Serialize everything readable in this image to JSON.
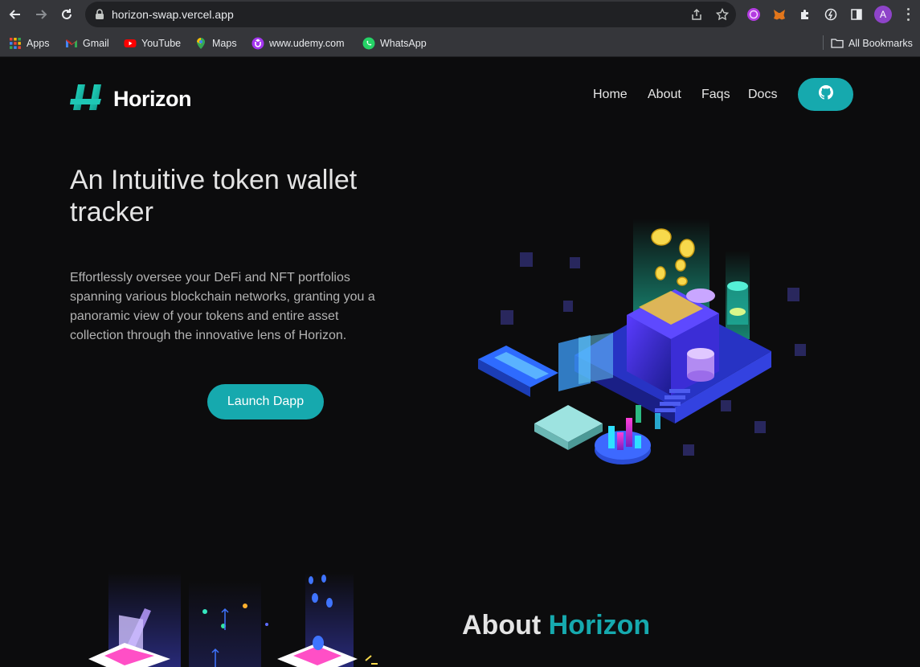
{
  "browser": {
    "url": "horizon-swap.vercel.app",
    "avatar_letter": "A",
    "bookmarks": [
      {
        "label": "Apps",
        "icon": "apps-grid-icon"
      },
      {
        "label": "Gmail",
        "icon": "gmail-icon"
      },
      {
        "label": "YouTube",
        "icon": "youtube-icon"
      },
      {
        "label": "Maps",
        "icon": "maps-icon"
      },
      {
        "label": "www.udemy.com",
        "icon": "udemy-icon"
      },
      {
        "label": "WhatsApp",
        "icon": "whatsapp-icon"
      }
    ],
    "all_bookmarks": "All Bookmarks"
  },
  "header": {
    "logo_text": "Horizon",
    "nav": [
      "Home",
      "About",
      "Faqs",
      "Docs"
    ],
    "github_icon": "github-icon"
  },
  "hero": {
    "title": "An Intuitive token wallet tracker",
    "description": "Effortlessly oversee your DeFi and NFT portfolios spanning various blockchain networks, granting you a panoramic view of your tokens and entire asset collection through the innovative lens of Horizon.",
    "cta": "Launch Dapp"
  },
  "about": {
    "title_prefix": "About ",
    "title_accent": "Horizon"
  },
  "colors": {
    "accent": "#16a9ae",
    "background": "#0c0c0d",
    "chrome": "#35363a"
  }
}
